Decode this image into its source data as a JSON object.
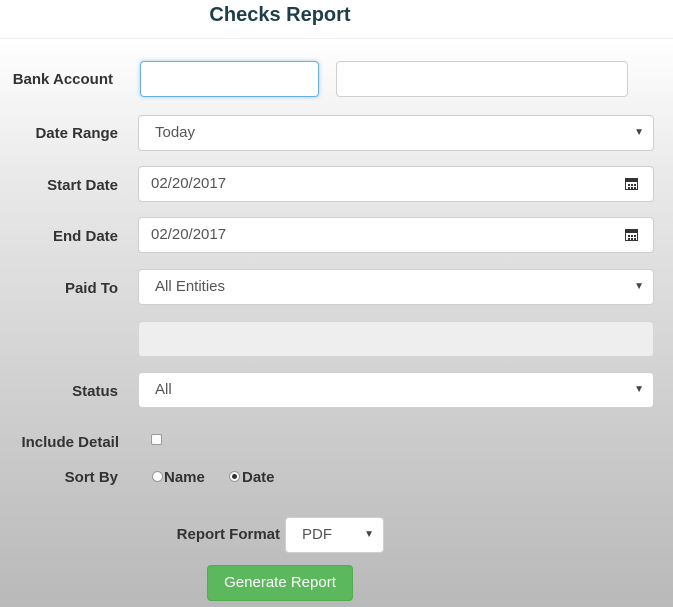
{
  "title": "Checks Report",
  "labels": {
    "bank_account": "Bank Account",
    "date_range": "Date Range",
    "start_date": "Start Date",
    "end_date": "End Date",
    "paid_to": "Paid To",
    "status": "Status",
    "include_detail": "Include Detail",
    "sort_by": "Sort By",
    "report_format": "Report Format"
  },
  "fields": {
    "bank_account_code": "",
    "bank_account_name": "",
    "date_range": "Today",
    "start_date": "02/20/2017",
    "end_date": "02/20/2017",
    "paid_to": "All Entities",
    "paid_to_detail": "",
    "status": "All",
    "include_detail": false,
    "sort_by_options": [
      "Name",
      "Date"
    ],
    "sort_by_selected": "Date",
    "report_format": "PDF"
  },
  "buttons": {
    "generate": "Generate Report"
  },
  "icons": {
    "calendar": "calendar-icon",
    "dropdown": "caret-down-icon"
  },
  "colors": {
    "primary_button": "#5cb85c",
    "focus_border": "#66afe9",
    "title": "#1f3d4a"
  }
}
